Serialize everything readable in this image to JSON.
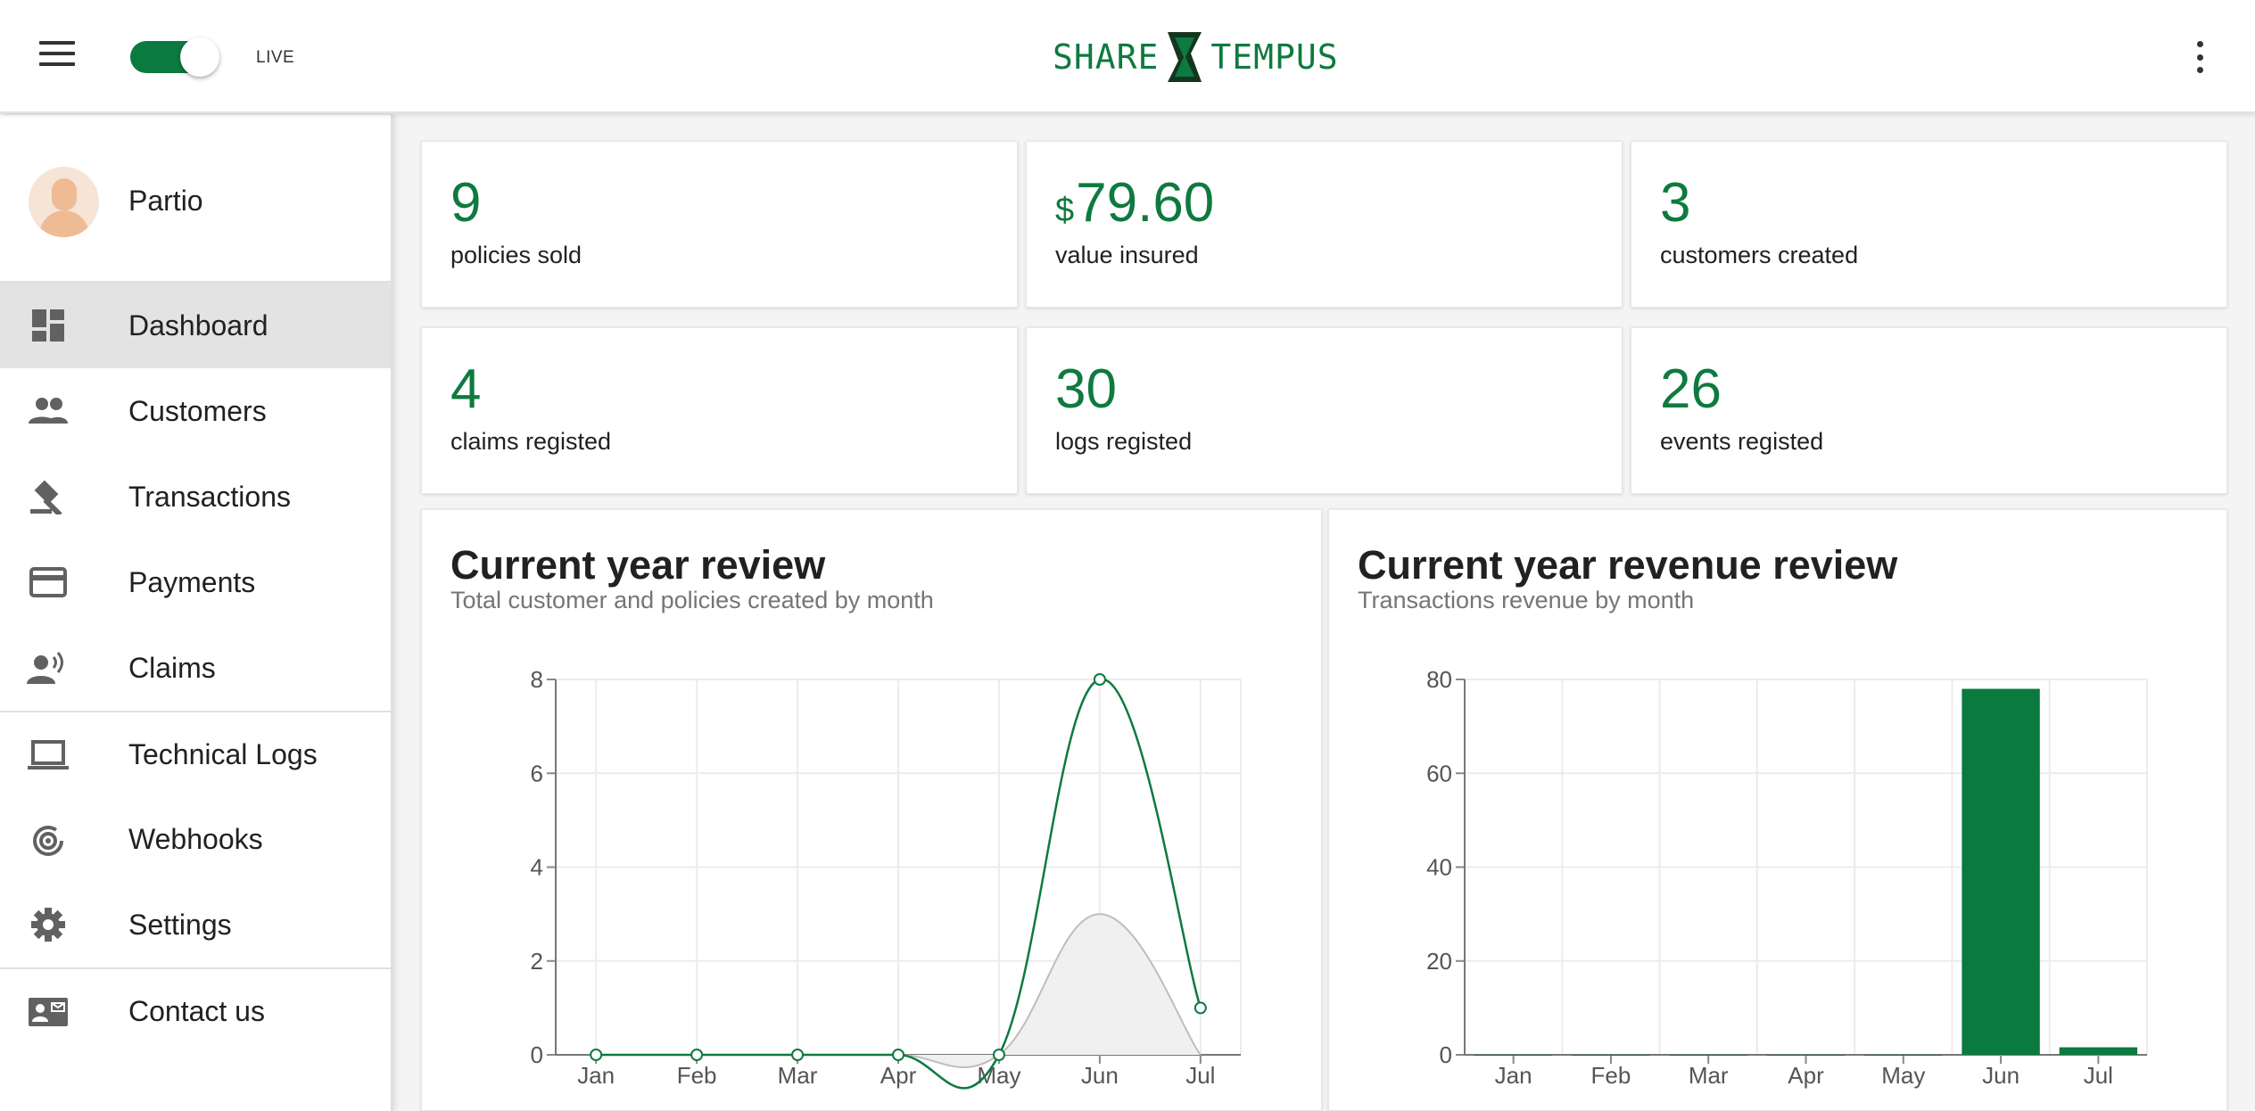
{
  "header": {
    "live_label": "LIVE",
    "live_on": true,
    "logo_left": "SHARE",
    "logo_right": "TEMPUS",
    "brand_color": "#0e7a3f"
  },
  "sidebar": {
    "user_name": "Partio",
    "items": [
      {
        "label": "Dashboard",
        "icon": "dashboard-icon",
        "active": true
      },
      {
        "label": "Customers",
        "icon": "people-icon"
      },
      {
        "label": "Transactions",
        "icon": "gavel-icon"
      },
      {
        "label": "Payments",
        "icon": "credit-card-icon"
      },
      {
        "label": "Claims",
        "icon": "record-voice-icon"
      },
      {
        "label": "Technical Logs",
        "icon": "laptop-icon"
      },
      {
        "label": "Webhooks",
        "icon": "webhook-icon"
      },
      {
        "label": "Settings",
        "icon": "gear-icon"
      },
      {
        "label": "Contact us",
        "icon": "contact-mail-icon"
      }
    ]
  },
  "stats": [
    {
      "value": "9",
      "label": "policies sold"
    },
    {
      "currency": "$",
      "value": "79.60",
      "label": "value insured"
    },
    {
      "value": "3",
      "label": "customers created"
    },
    {
      "value": "4",
      "label": "claims registed"
    },
    {
      "value": "30",
      "label": "logs registed"
    },
    {
      "value": "26",
      "label": "events registed"
    }
  ],
  "chart_data": [
    {
      "type": "area",
      "title": "Current year review",
      "subtitle": "Total customer and policies created by month",
      "categories": [
        "Jan",
        "Feb",
        "Mar",
        "Apr",
        "May",
        "Jun",
        "Jul"
      ],
      "ylim": [
        0,
        8
      ],
      "yticks": [
        0,
        2,
        4,
        6,
        8
      ],
      "grid": true,
      "series": [
        {
          "values": [
            0,
            0,
            0,
            0,
            0,
            8,
            1
          ],
          "color": "#0e7a3f"
        },
        {
          "values": [
            0,
            0,
            0,
            0,
            0,
            3,
            0
          ],
          "color": "#bdbdbd"
        }
      ]
    },
    {
      "type": "bar",
      "title": "Current year revenue review",
      "subtitle": "Transactions revenue by month",
      "categories": [
        "Jan",
        "Feb",
        "Mar",
        "Apr",
        "May",
        "Jun",
        "Jul"
      ],
      "values": [
        0,
        0,
        0,
        0,
        0,
        78,
        1.6
      ],
      "ylim": [
        0,
        80
      ],
      "yticks": [
        0,
        20,
        40,
        60,
        80
      ],
      "grid": true,
      "color": "#0b7a3e"
    }
  ]
}
